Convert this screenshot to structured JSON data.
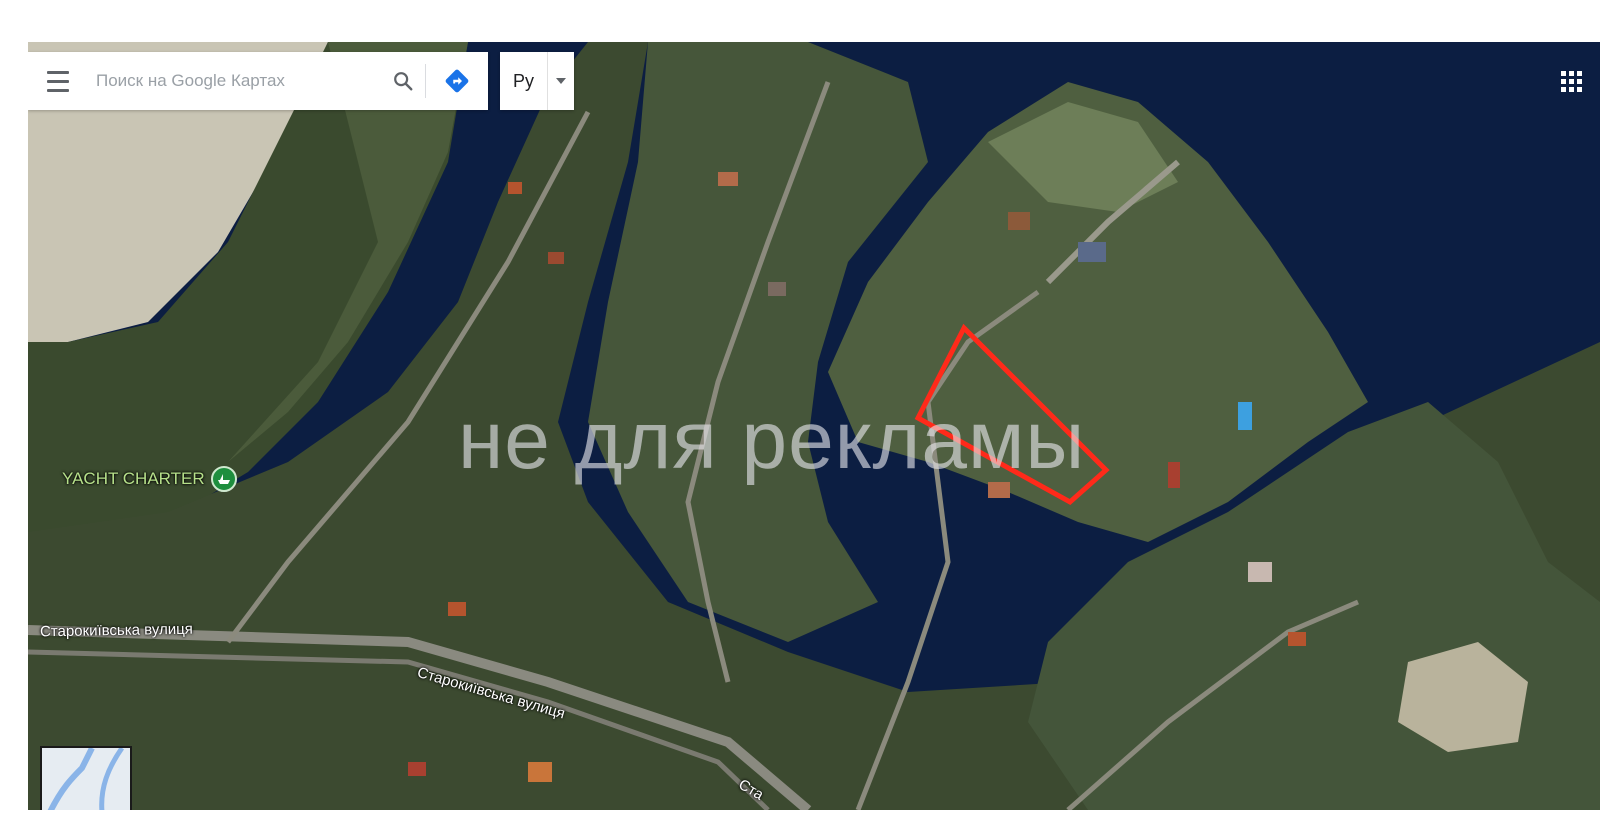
{
  "search": {
    "placeholder": "Поиск на Google Картах"
  },
  "language": {
    "label": "Ру"
  },
  "places": {
    "yacht_charter": "YACHT CHARTER"
  },
  "streets": {
    "street_1": "Старокиївська вулиця",
    "street_2": "Старокиївська вулиця",
    "street_3": "Ста"
  },
  "watermark": "не для рекламы",
  "colors": {
    "boundary": "#ff2a1a",
    "water": "#0b1d3f",
    "yacht_label": "#b6e08a"
  },
  "icons": [
    "menu-icon",
    "search-icon",
    "directions-icon",
    "chevron-down-icon",
    "apps-grid-icon",
    "boat-icon"
  ]
}
